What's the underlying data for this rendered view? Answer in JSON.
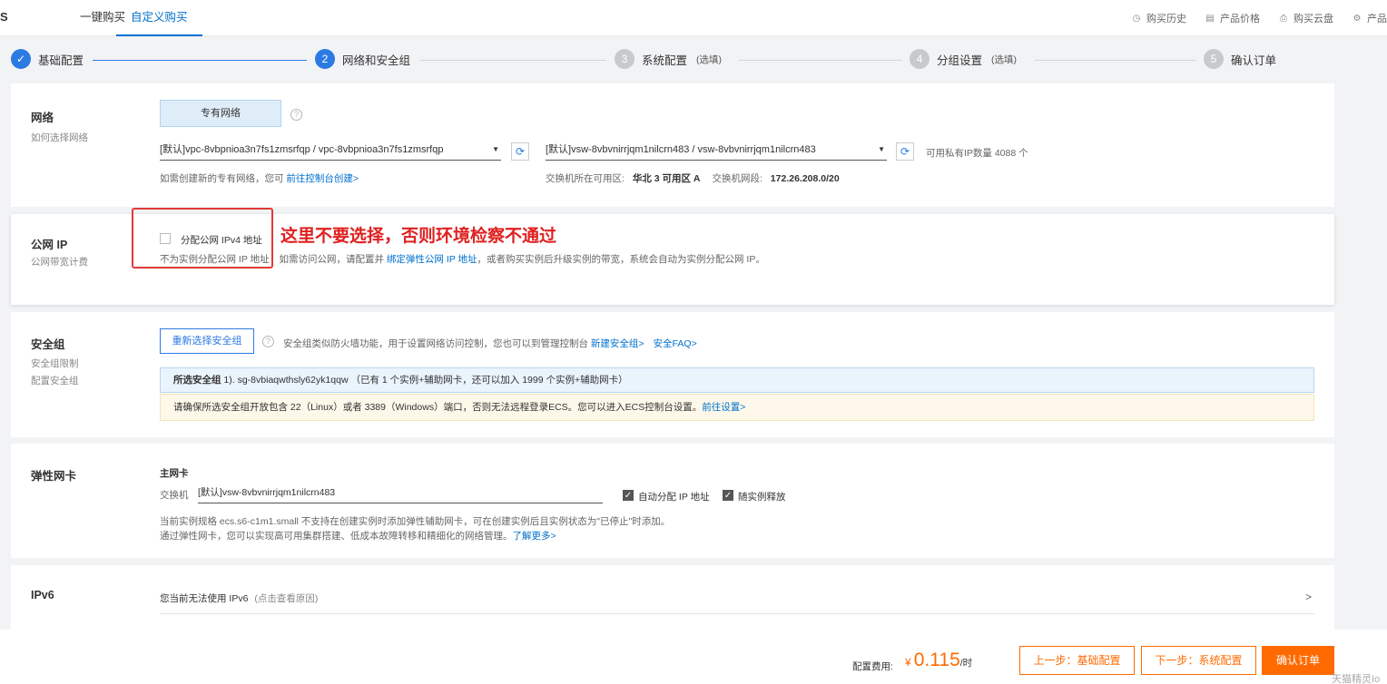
{
  "topbar": {
    "brand": "S",
    "tabs": [
      "一键购买",
      "自定义购买"
    ],
    "links": [
      "购买历史",
      "产品价格",
      "购买云盘",
      "产品"
    ]
  },
  "steps": [
    {
      "num": "✓",
      "label": "基础配置",
      "opt": ""
    },
    {
      "num": "2",
      "label": "网络和安全组",
      "opt": ""
    },
    {
      "num": "3",
      "label": "系统配置",
      "opt": "(选填)"
    },
    {
      "num": "4",
      "label": "分组设置",
      "opt": "(选填)"
    },
    {
      "num": "5",
      "label": "确认订单",
      "opt": ""
    }
  ],
  "network": {
    "title": "网络",
    "sub": "如何选择网络",
    "tab": "专有网络",
    "vpc": "[默认]vpc-8vbpnioa3n7fs1zmsrfqp / vpc-8vbpnioa3n7fs1zmsrfqp",
    "vswitch": "[默认]vsw-8vbvnirrjqm1nilcrn483 / vsw-8vbvnirrjqm1nilcrn483",
    "ip_count": "可用私有IP数量 4088 个",
    "vpc_hint_prefix": "如需创建新的专有网络，您可 ",
    "vpc_hint_link": "前往控制台创建>",
    "zone_label": "交换机所在可用区:",
    "zone_value": "华北 3 可用区 A",
    "cidr_label": "交换机网段:",
    "cidr_value": "172.26.208.0/20"
  },
  "public_ip": {
    "title": "公网 IP",
    "sub": "公网带宽计费",
    "checkbox_label": "分配公网 IPv4 地址",
    "desc_left": "不为实例分配公网 IP 地址",
    "desc_mid": "如需访问公网，请配置并 ",
    "desc_link": "绑定弹性公网 IP 地址",
    "desc_right": "，或者购买实例后升级实例的带宽，系统会自动为实例分配公网 IP。",
    "annotation": "这里不要选择，否则环境检察不通过"
  },
  "security": {
    "title": "安全组",
    "sub1": "安全组限制",
    "sub2": "配置安全组",
    "button": "重新选择安全组",
    "desc": "安全组类似防火墙功能，用于设置网络访问控制，您也可以到管理控制台 ",
    "link1": "新建安全组>",
    "link2": "安全FAQ>",
    "selected_label": "所选安全组",
    "selected_value": "1). sg-8vbiaqwthsly62yk1qqw （已有 1 个实例+辅助网卡，还可以加入 1999 个实例+辅助网卡）",
    "warning": "请确保所选安全组开放包含 22（Linux）或者 3389（Windows）端口，否则无法远程登录ECS。您可以进入ECS控制台设置。",
    "warning_link": "前往设置>"
  },
  "eni": {
    "title": "弹性网卡",
    "primary": "主网卡",
    "switch_label": "交换机",
    "switch_value": "[默认]vsw-8vbvnirrjqm1nilcrn483",
    "auto_ip": "自动分配 IP 地址",
    "release": "随实例释放",
    "note1": "当前实例规格 ecs.s6-c1m1.small 不支持在创建实例时添加弹性辅助网卡，可在创建实例后且实例状态为\"已停止\"时添加。",
    "note2": "通过弹性网卡，您可以实现高可用集群搭建、低成本故障转移和精细化的网络管理。",
    "note2_link": "了解更多>"
  },
  "ipv6": {
    "title": "IPv6",
    "text": "您当前无法使用 IPv6",
    "hint": "(点击查看原因)",
    "chevron": ">"
  },
  "footer": {
    "fee_label": "配置费用:",
    "currency": "¥",
    "fee": "0.115",
    "unit": "/时",
    "prev": "上一步：基础配置",
    "next": "下一步：系统配置",
    "confirm": "确认订单"
  },
  "watermark": "天猫精灵Io"
}
